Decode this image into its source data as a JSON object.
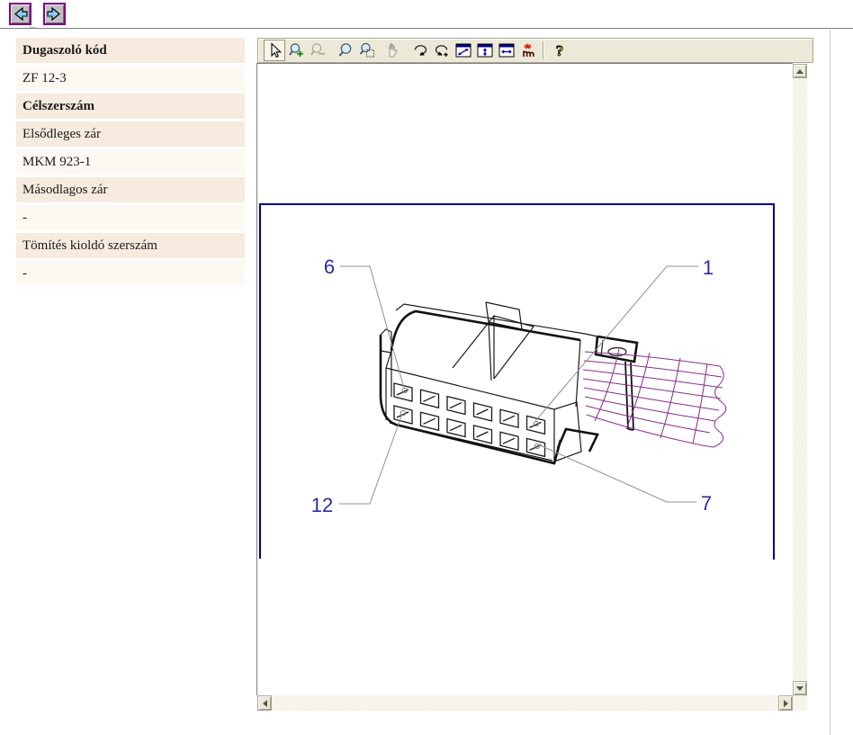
{
  "nav": {
    "back_icon": "arrow-left",
    "forward_icon": "arrow-right",
    "underscore_text": "_"
  },
  "sidebar": {
    "rows": [
      {
        "label": "Dugaszoló kód",
        "type": "header"
      },
      {
        "label": "ZF 12-3",
        "type": "value"
      },
      {
        "label": "Célszerszám",
        "type": "header"
      },
      {
        "label": "Elsődleges zár",
        "type": "label"
      },
      {
        "label": "MKM 923-1",
        "type": "value"
      },
      {
        "label": "Másodlagos zár",
        "type": "label"
      },
      {
        "label": "-",
        "type": "value"
      },
      {
        "label": "Tömítés kioldó szerszám",
        "type": "label"
      },
      {
        "label": "-",
        "type": "value"
      }
    ]
  },
  "toolbar": {
    "icons": [
      {
        "name": "select-cursor-icon",
        "state": "selected"
      },
      {
        "name": "zoom-in-icon",
        "state": "enabled"
      },
      {
        "name": "zoom-out-icon",
        "state": "disabled"
      },
      {
        "name": "zoom-icon",
        "state": "enabled"
      },
      {
        "name": "zoom-area-icon",
        "state": "enabled"
      },
      {
        "name": "pan-hand-icon",
        "state": "disabled"
      },
      {
        "name": "rotate-cw-icon",
        "state": "enabled"
      },
      {
        "name": "rotate-ccw-icon",
        "state": "enabled"
      },
      {
        "name": "fit-page-icon",
        "state": "enabled"
      },
      {
        "name": "fit-height-icon",
        "state": "enabled"
      },
      {
        "name": "fit-width-icon",
        "state": "enabled"
      },
      {
        "name": "hotspots-icon",
        "state": "enabled"
      },
      {
        "name": "help-icon",
        "state": "enabled"
      }
    ]
  },
  "diagram": {
    "type": "connector-technical-drawing",
    "connector_pins": 12,
    "pin_labels": [
      "6",
      "1",
      "12",
      "7"
    ],
    "frame_color": "#00008B",
    "label_color": "#2B2BA6",
    "wire_color": "#8B2E8B",
    "line_color": "#1a1a1a",
    "leader_color": "#909090"
  },
  "colors": {
    "sidebar_shade": "#F6EBDE",
    "sidebar_light": "#FCF9F3",
    "toolbar_bg": "#ECE9D8",
    "nav_border": "#800080",
    "nav_face": "#C0C0C0"
  }
}
